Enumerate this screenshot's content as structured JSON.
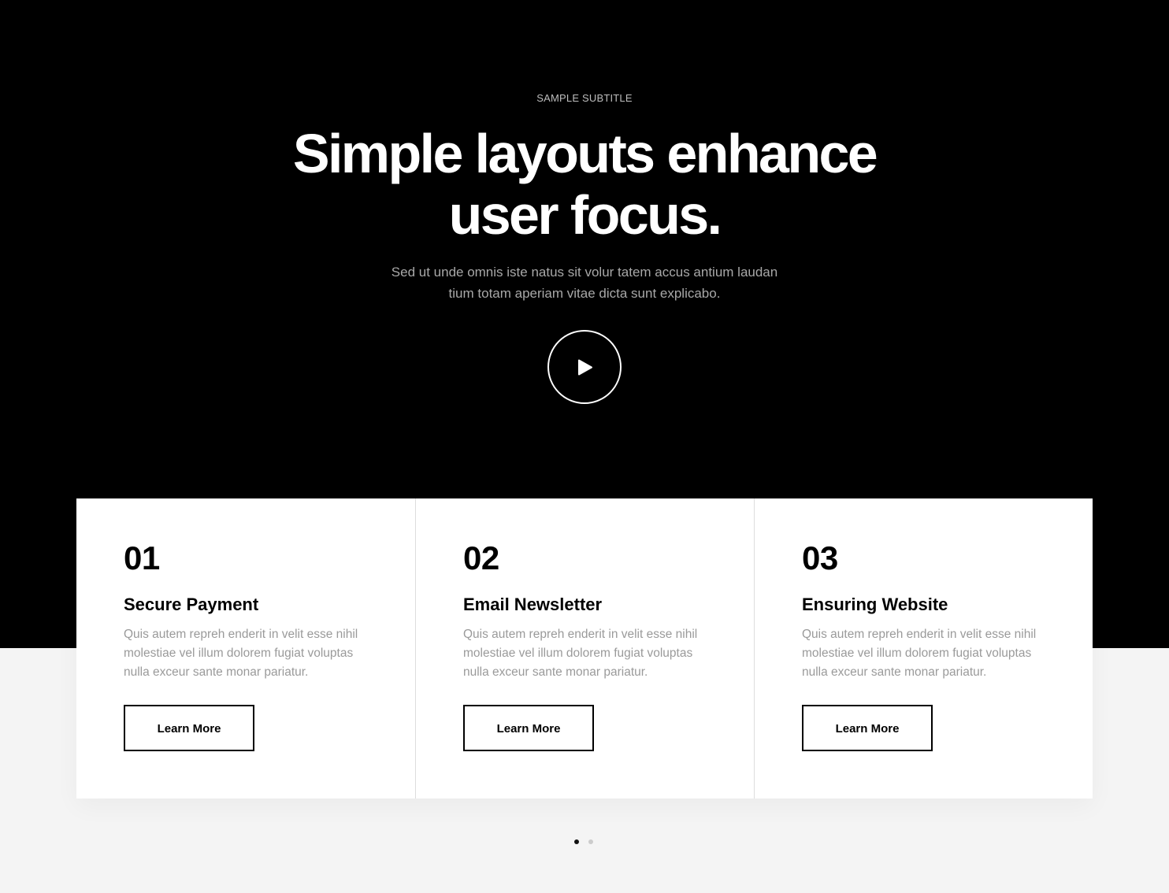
{
  "hero": {
    "subtitle": "SAMPLE SUBTITLE",
    "title_line1": "Simple layouts enhance",
    "title_line2": "user focus.",
    "description_line1": "Sed ut unde omnis iste natus sit volur tatem accus antium laudan",
    "description_line2": "tium totam aperiam vitae dicta sunt explicabo.",
    "play_icon": "play-icon"
  },
  "cards": [
    {
      "number": "01",
      "title": "Secure Payment",
      "text": "Quis autem repreh enderit in velit esse nihil molestiae vel illum dolorem fugiat voluptas nulla exceur sante monar pariatur.",
      "button_label": "Learn More"
    },
    {
      "number": "02",
      "title": "Email Newsletter",
      "text": "Quis autem repreh enderit in velit esse nihil molestiae vel illum dolorem fugiat voluptas nulla exceur sante monar pariatur.",
      "button_label": "Learn More"
    },
    {
      "number": "03",
      "title": "Ensuring Website",
      "text": "Quis autem repreh enderit in velit esse nihil molestiae vel illum dolorem fugiat voluptas nulla exceur sante monar pariatur.",
      "button_label": "Learn More"
    }
  ],
  "pagination": {
    "total": 2,
    "active": 1
  },
  "colors": {
    "hero_background": "#000000",
    "page_background": "#f4f4f4",
    "card_background": "#ffffff",
    "muted_text": "#9a9a9a"
  }
}
